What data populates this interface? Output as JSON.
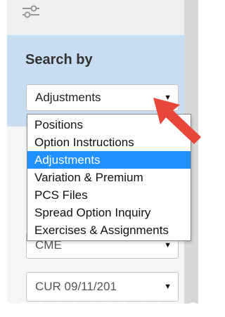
{
  "search": {
    "heading": "Search by",
    "selected_value": "Adjustments"
  },
  "dropdown": {
    "options": [
      "Positions",
      "Option Instructions",
      "Adjustments",
      "Variation & Premium",
      "PCS Files",
      "Spread Option Inquiry",
      "Exercises & Assignments"
    ],
    "selected_index": 2
  },
  "exchange_select": {
    "value": "CME"
  },
  "date_select": {
    "value": "CUR 09/11/201"
  },
  "icons": {
    "filter": "sliders-filter-icon",
    "caret": "caret-down-icon",
    "annotation": "red-arrow-pointer"
  },
  "colors": {
    "band": "#c8dcf2",
    "selection": "#1e90ff",
    "annotation_arrow": "#e8463a"
  }
}
